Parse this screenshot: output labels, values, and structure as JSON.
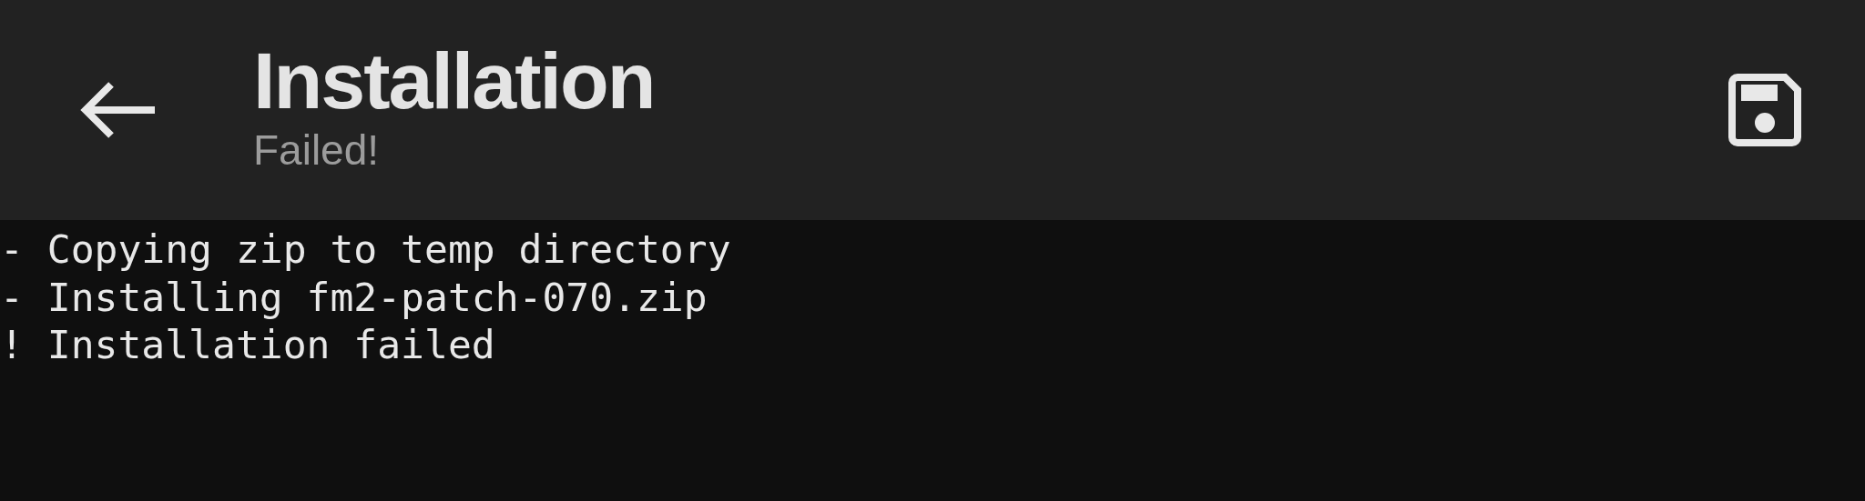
{
  "toolbar": {
    "title": "Installation",
    "subtitle": "Failed!"
  },
  "log": [
    "- Copying zip to temp directory",
    "- Installing fm2-patch-070.zip",
    "! Installation failed"
  ]
}
